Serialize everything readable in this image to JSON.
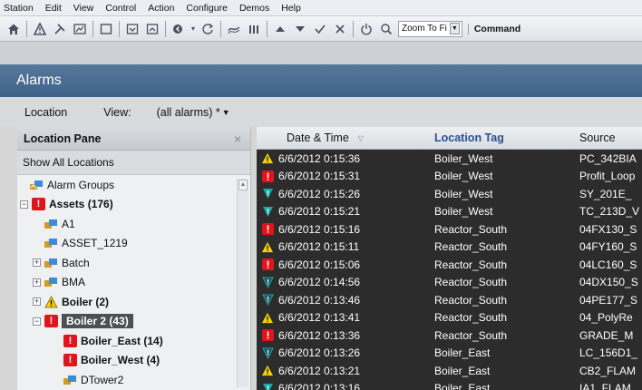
{
  "menu": [
    "Station",
    "Edit",
    "View",
    "Control",
    "Action",
    "Configure",
    "Demos",
    "Help"
  ],
  "toolbar": {
    "zoom_value": "Zoom To Fi",
    "command_label": "Command"
  },
  "alarms_title": "Alarms",
  "filter": {
    "location_label": "Location",
    "view_label": "View:",
    "view_value": "(all alarms) *"
  },
  "location_pane": {
    "title": "Location Pane",
    "close": "×",
    "show_all": "Show All Locations",
    "tree": [
      {
        "label": "Alarm Groups",
        "icon": "alarm-groups-icon",
        "indent": 0
      },
      {
        "label": "Assets (176)",
        "icon": "alarm-red-icon",
        "indent": 0
      },
      {
        "label": "A1",
        "icon": "asset-icon",
        "indent": 1
      },
      {
        "label": "ASSET_1219",
        "icon": "asset-icon",
        "indent": 1
      },
      {
        "label": "Batch",
        "icon": "asset-icon",
        "indent": 1
      },
      {
        "label": "BMA",
        "icon": "asset-icon",
        "indent": 1
      },
      {
        "label": "Boiler (2)",
        "icon": "warning-yellow-icon",
        "indent": 1
      },
      {
        "label": "Boiler 2 (43)",
        "icon": "alarm-red-icon",
        "indent": 1
      },
      {
        "label": "Boiler_East (14)",
        "icon": "alarm-red-icon",
        "indent": 2
      },
      {
        "label": "Boiler_West (4)",
        "icon": "alarm-red-icon",
        "indent": 2
      },
      {
        "label": "DTower2",
        "icon": "asset-icon",
        "indent": 2
      }
    ]
  },
  "grid": {
    "headers": {
      "date": "Date & Time",
      "location": "Location Tag",
      "source": "Source"
    },
    "rows": [
      {
        "icon": "warning-yellow-icon",
        "date": "6/6/2012 0:15:36",
        "location": "Boiler_West",
        "source": "PC_342BIA"
      },
      {
        "icon": "alarm-red-icon",
        "date": "6/6/2012 0:15:31",
        "location": "Boiler_West",
        "source": "Profit_Loop"
      },
      {
        "icon": "shield-teal-icon",
        "date": "6/6/2012 0:15:26",
        "location": "Boiler_West",
        "source": "SY_201E_"
      },
      {
        "icon": "shield-teal-icon",
        "date": "6/6/2012 0:15:21",
        "location": "Boiler_West",
        "source": "TC_213D_V"
      },
      {
        "icon": "alarm-red-icon",
        "date": "6/6/2012 0:15:16",
        "location": "Reactor_South",
        "source": "04FX130_S"
      },
      {
        "icon": "warning-yellow-icon",
        "date": "6/6/2012 0:15:11",
        "location": "Reactor_South",
        "source": "04FY160_S"
      },
      {
        "icon": "alarm-red-icon",
        "date": "6/6/2012 0:15:06",
        "location": "Reactor_South",
        "source": "04LC160_S"
      },
      {
        "icon": "shield-dark-icon",
        "date": "6/6/2012 0:14:56",
        "location": "Reactor_South",
        "source": "04DX150_S"
      },
      {
        "icon": "shield-dark-icon",
        "date": "6/6/2012 0:13:46",
        "location": "Reactor_South",
        "source": "04PE177_S"
      },
      {
        "icon": "warning-yellow-icon",
        "date": "6/6/2012 0:13:41",
        "location": "Reactor_South",
        "source": "04_PolyRe"
      },
      {
        "icon": "alarm-red-icon",
        "date": "6/6/2012 0:13:36",
        "location": "Reactor_South",
        "source": "GRADE_M"
      },
      {
        "icon": "shield-dark-icon",
        "date": "6/6/2012 0:13:26",
        "location": "Boiler_East",
        "source": "LC_156D1_"
      },
      {
        "icon": "warning-yellow-icon",
        "date": "6/6/2012 0:13:21",
        "location": "Boiler_East",
        "source": "CB2_FLAM"
      },
      {
        "icon": "shield-teal-icon",
        "date": "6/6/2012 0:13:16",
        "location": "Boiler_East",
        "source": "IA1_FLAM"
      }
    ]
  },
  "colors": {
    "alarm_red": "#e0141b",
    "warning_yellow": "#f5d10a",
    "shield_teal": "#18a9a6",
    "grid_bg": "#2c2c2c",
    "header_blue": "#4a6d92"
  }
}
